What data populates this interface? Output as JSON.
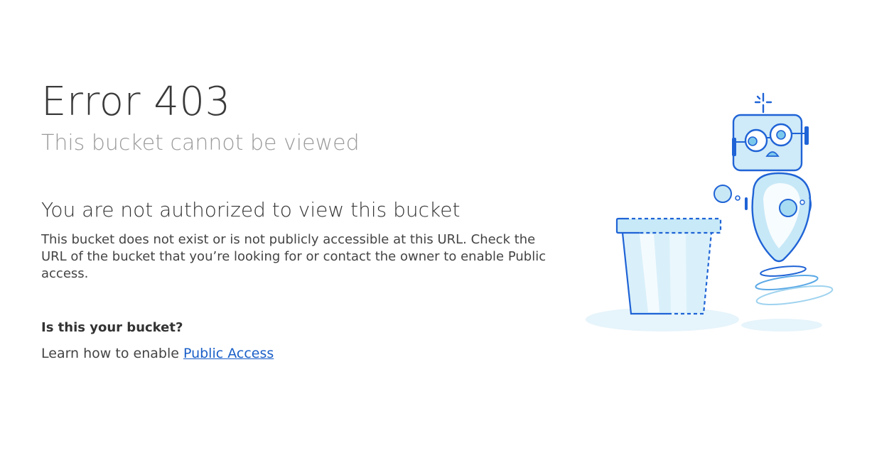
{
  "error": {
    "title": "Error 403",
    "subtitle": "This bucket cannot be viewed"
  },
  "message": {
    "heading": "You are not authorized to view this bucket",
    "body": "This bucket does not exist or is not publicly accessible at this URL. Check the URL of the bucket that you’re looking for or contact the owner to enable Public access."
  },
  "owner": {
    "question": "Is this your bucket?",
    "learn_prefix": "Learn how to enable",
    "link_label": "Public Access"
  },
  "illustration": {
    "icon": "robot-with-empty-bucket-icon",
    "colors": {
      "outline": "#1f63d6",
      "fill_light": "#d6eefa",
      "fill_mid": "#a9dcf2",
      "shadow": "#e6f4fb"
    }
  }
}
